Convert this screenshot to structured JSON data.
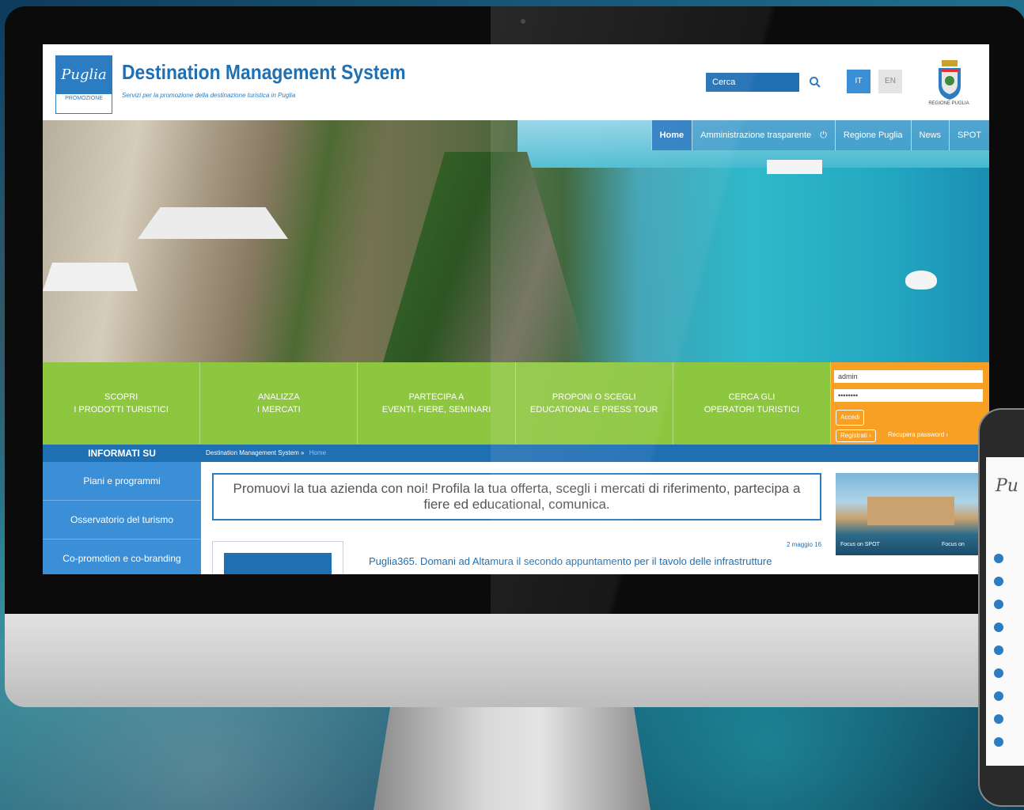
{
  "header": {
    "logo_text": "Puglia",
    "logo_sub": "PROMOZIONE",
    "title": "Destination Management System",
    "subtitle": "Servizi per la promozione della destinazione turistica in Puglia",
    "search_placeholder": "Cerca",
    "lang_it": "IT",
    "lang_en": "EN",
    "region_label": "REGIONE PUGLIA"
  },
  "nav": {
    "items": [
      "Home",
      "Amministrazione trasparente",
      "Regione Puglia",
      "News",
      "SPOT"
    ],
    "active": "Home"
  },
  "green_menu": [
    "SCOPRI\nI PRODOTTI TURISTICI",
    "ANALIZZA\nI MERCATI",
    "PARTECIPA A\nEVENTI, FIERE, SEMINARI",
    "PROPONI O SCEGLI\nEDUCATIONAL E PRESS TOUR",
    "CERCA GLI\nOPERATORI TURISTICI"
  ],
  "login": {
    "username_value": "admin",
    "password_value": "••••••••",
    "login_button": "Accedi",
    "register_link": "Registrati ›",
    "recover_link": "Recupera password ›"
  },
  "sidebar": {
    "heading": "INFORMATI SU",
    "items": [
      "Piani e programmi",
      "Osservatorio del turismo",
      "Co-promotion e co-branding"
    ]
  },
  "breadcrumb": {
    "root": "Destination Management System »",
    "current": "Home"
  },
  "promo": {
    "text": "Promuovi la tua azienda con noi! Profila la tua offerta, scegli i mercati di riferimento, partecipa a fiere ed educational, comunica."
  },
  "focus": {
    "left_label": "Focus on SPOT",
    "right_label": "Focus on"
  },
  "news": {
    "date": "2 maggio 16",
    "title": "Puglia365. Domani ad Altamura il secondo appuntamento per il tavolo delle infrastrutture"
  },
  "phone": {
    "logo_text": "Pu"
  },
  "colors": {
    "brand_blue": "#1f6fb3",
    "green": "#8dc63f",
    "orange": "#f7a023"
  }
}
